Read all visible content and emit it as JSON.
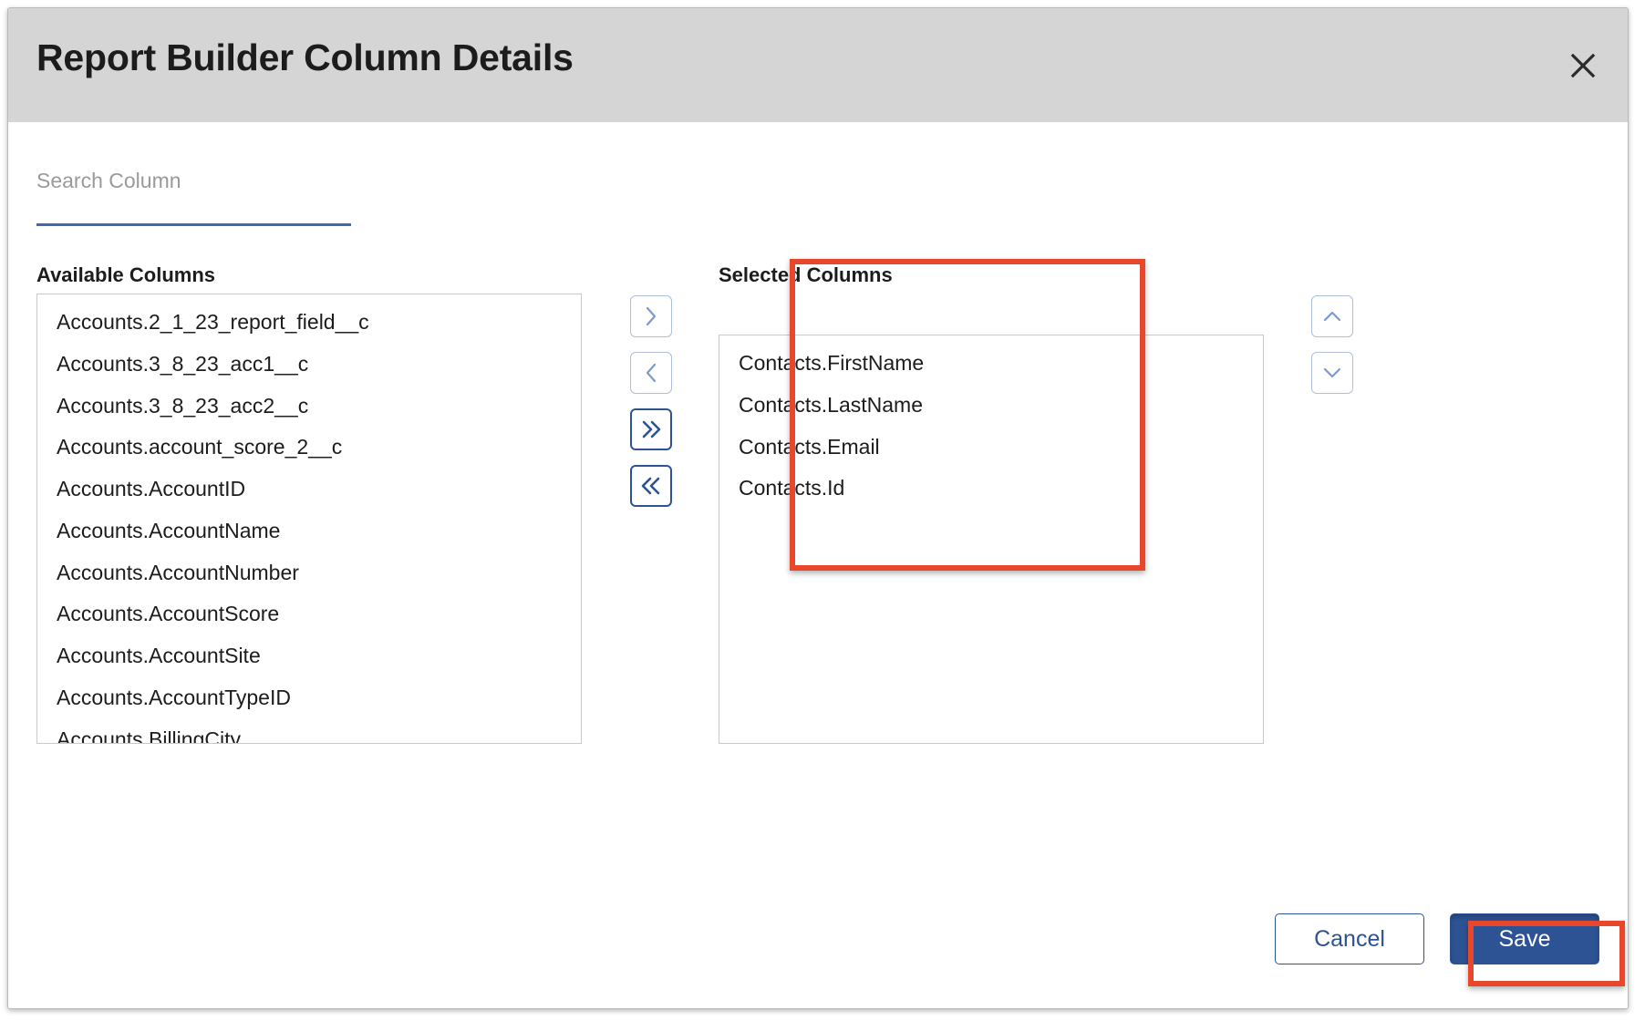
{
  "modal": {
    "title": "Report Builder Column Details",
    "close_icon": "close-icon"
  },
  "search": {
    "placeholder": "Search Column",
    "value": "",
    "underline_color": "#3f6ab0"
  },
  "available": {
    "label": "Available Columns",
    "items": [
      "Accounts.2_1_23_report_field__c",
      "Accounts.3_8_23_acc1__c",
      "Accounts.3_8_23_acc2__c",
      "Accounts.account_score_2__c",
      "Accounts.AccountID",
      "Accounts.AccountName",
      "Accounts.AccountNumber",
      "Accounts.AccountScore",
      "Accounts.AccountSite",
      "Accounts.AccountTypeID",
      "Accounts.BillingCity"
    ]
  },
  "selected": {
    "label": "Selected Columns",
    "items": [
      "Contacts.FirstName",
      "Contacts.LastName",
      "Contacts.Email",
      "Contacts.Id"
    ]
  },
  "transfer_buttons": [
    {
      "name": "move-right-button",
      "icon": "chevron-right-icon",
      "glyph": "›",
      "style": "light"
    },
    {
      "name": "move-left-button",
      "icon": "chevron-left-icon",
      "glyph": "‹",
      "style": "light"
    },
    {
      "name": "move-all-right-button",
      "icon": "chevron-double-right-icon",
      "glyph": "»",
      "style": "dark"
    },
    {
      "name": "move-all-left-button",
      "icon": "chevron-double-left-icon",
      "glyph": "«",
      "style": "dark"
    }
  ],
  "reorder_buttons": [
    {
      "name": "move-up-button",
      "icon": "chevron-up-icon",
      "glyph": "⌃",
      "style": "light"
    },
    {
      "name": "move-down-button",
      "icon": "chevron-down-icon",
      "glyph": "⌄",
      "style": "light"
    }
  ],
  "footer": {
    "cancel_label": "Cancel",
    "save_label": "Save"
  },
  "colors": {
    "header_bg": "#d5d5d5",
    "primary": "#2d5395",
    "primary_light": "#7e9ac8",
    "annotation": "#e8472c",
    "text": "#1c1c1c",
    "placeholder": "#9a9a9a"
  },
  "annotations": [
    {
      "name": "annotation-selected-columns",
      "target": "selected-columns-panel"
    },
    {
      "name": "annotation-save-button",
      "target": "save-button"
    }
  ]
}
